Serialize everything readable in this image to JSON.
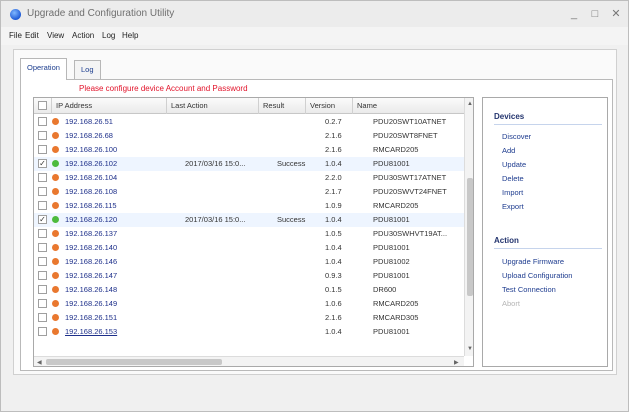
{
  "window": {
    "title": "Upgrade and Configuration Utility",
    "controls": {
      "minimize": "_",
      "maximize": "□",
      "close": "✕"
    }
  },
  "menu": [
    "File",
    "Edit",
    "View",
    "Action",
    "Log",
    "Help"
  ],
  "tabs": [
    {
      "label": "Operation",
      "active": true
    },
    {
      "label": "Log",
      "active": false
    }
  ],
  "warning": "Please configure device Account and Password",
  "table": {
    "columns": [
      "",
      "IP Address",
      "Last Action",
      "Result",
      "Version",
      "Name"
    ],
    "rows": [
      {
        "checked": false,
        "status": "orange",
        "ip": "192.168.26.51",
        "last_action": "",
        "result": "",
        "version": "0.2.7",
        "name": "PDU20SWT10ATNET"
      },
      {
        "checked": false,
        "status": "orange",
        "ip": "192.168.26.68",
        "last_action": "",
        "result": "",
        "version": "2.1.6",
        "name": "PDU20SWT8FNET"
      },
      {
        "checked": false,
        "status": "orange",
        "ip": "192.168.26.100",
        "last_action": "",
        "result": "",
        "version": "2.1.6",
        "name": "RMCARD205"
      },
      {
        "checked": true,
        "status": "green",
        "ip": "192.168.26.102",
        "last_action": "2017/03/16 15:0...",
        "result": "Success",
        "version": "1.0.4",
        "name": "PDU81001"
      },
      {
        "checked": false,
        "status": "orange",
        "ip": "192.168.26.104",
        "last_action": "",
        "result": "",
        "version": "2.2.0",
        "name": "PDU30SWT17ATNET"
      },
      {
        "checked": false,
        "status": "orange",
        "ip": "192.168.26.108",
        "last_action": "",
        "result": "",
        "version": "2.1.7",
        "name": "PDU20SWVT24FNET"
      },
      {
        "checked": false,
        "status": "orange",
        "ip": "192.168.26.115",
        "last_action": "",
        "result": "",
        "version": "1.0.9",
        "name": "RMCARD205"
      },
      {
        "checked": true,
        "status": "green",
        "ip": "192.168.26.120",
        "last_action": "2017/03/16 15:0...",
        "result": "Success",
        "version": "1.0.4",
        "name": "PDU81001"
      },
      {
        "checked": false,
        "status": "orange",
        "ip": "192.168.26.137",
        "last_action": "",
        "result": "",
        "version": "1.0.5",
        "name": "PDU30SWHVT19AT..."
      },
      {
        "checked": false,
        "status": "orange",
        "ip": "192.168.26.140",
        "last_action": "",
        "result": "",
        "version": "1.0.4",
        "name": "PDU81001"
      },
      {
        "checked": false,
        "status": "orange",
        "ip": "192.168.26.146",
        "last_action": "",
        "result": "",
        "version": "1.0.4",
        "name": "PDU81002"
      },
      {
        "checked": false,
        "status": "orange",
        "ip": "192.168.26.147",
        "last_action": "",
        "result": "",
        "version": "0.9.3",
        "name": "PDU81001"
      },
      {
        "checked": false,
        "status": "orange",
        "ip": "192.168.26.148",
        "last_action": "",
        "result": "",
        "version": "0.1.5",
        "name": "DR600"
      },
      {
        "checked": false,
        "status": "orange",
        "ip": "192.168.26.149",
        "last_action": "",
        "result": "",
        "version": "1.0.6",
        "name": "RMCARD205"
      },
      {
        "checked": false,
        "status": "orange",
        "ip": "192.168.26.151",
        "last_action": "",
        "result": "",
        "version": "2.1.6",
        "name": "RMCARD305"
      },
      {
        "checked": false,
        "status": "orange",
        "ip": "192.168.26.153",
        "last_action": "",
        "result": "",
        "version": "1.0.4",
        "name": "PDU81001"
      }
    ]
  },
  "status_colors": {
    "orange": "#e9782f",
    "green": "#4dbb3d"
  },
  "devices": {
    "heading": "Devices",
    "items": [
      "Discover",
      "Add",
      "Update",
      "Delete",
      "Import",
      "Export"
    ]
  },
  "actions": {
    "heading": "Action",
    "items": [
      {
        "label": "Upgrade Firmware",
        "enabled": true
      },
      {
        "label": "Upload Configuration",
        "enabled": true
      },
      {
        "label": "Test Connection",
        "enabled": true
      },
      {
        "label": "Abort",
        "enabled": false
      }
    ]
  },
  "scroll_arrows": {
    "up": "▲",
    "down": "▼",
    "left": "◀",
    "right": "▶"
  }
}
